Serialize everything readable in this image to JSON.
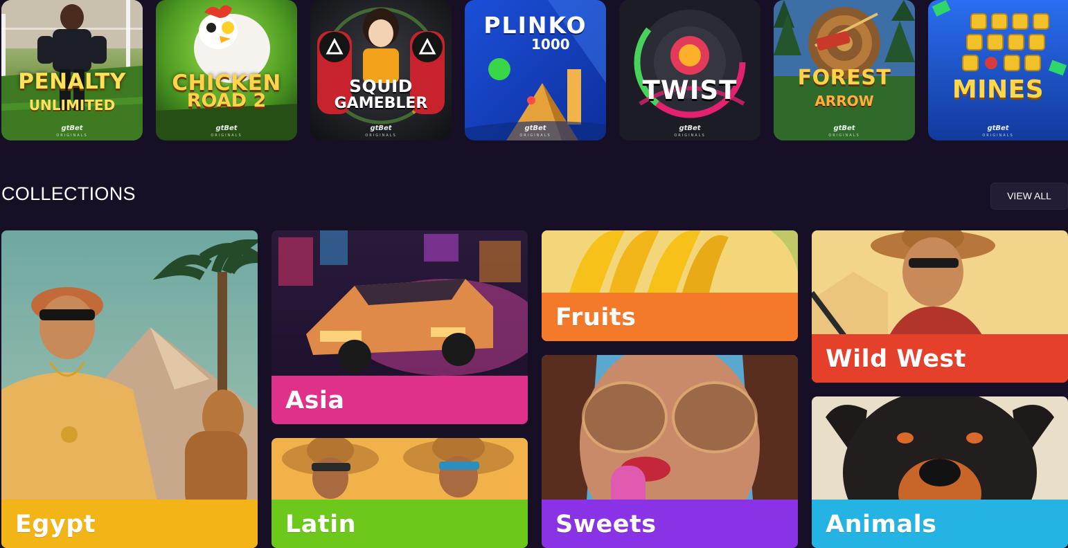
{
  "games": [
    {
      "title": "PENALTY",
      "subtitle": "UNLIMITED",
      "brand": "gtBet",
      "brand_sub": "ORIGINALS"
    },
    {
      "title": "CHICKEN",
      "subtitle": "ROAD 2",
      "brand": "gtBet",
      "brand_sub": "ORIGINALS"
    },
    {
      "title": "SQUID",
      "subtitle": "GAMEBLER",
      "brand": "gtBet",
      "brand_sub": "ORIGINALS"
    },
    {
      "title": "PLINKO",
      "subtitle": "1000",
      "brand": "gtBet",
      "brand_sub": "ORIGINALS"
    },
    {
      "title": "TWIST",
      "subtitle": "",
      "brand": "gtBet",
      "brand_sub": "ORIGINALS"
    },
    {
      "title": "FOREST",
      "subtitle": "ARROW",
      "brand": "gtBet",
      "brand_sub": "ORIGINALS"
    },
    {
      "title": "MINES",
      "subtitle": "",
      "brand": "gtBet",
      "brand_sub": "ORIGINALS"
    }
  ],
  "collections": {
    "title": "COLLECTIONS",
    "view_all_label": "VIEW ALL",
    "items": [
      {
        "label": "Egypt",
        "color": "#f2b417"
      },
      {
        "label": "Asia",
        "color": "#e0318a"
      },
      {
        "label": "Latin",
        "color": "#6cc81a"
      },
      {
        "label": "Fruits",
        "color": "#f47a2a"
      },
      {
        "label": "Sweets",
        "color": "#8a32e6"
      },
      {
        "label": "Wild West",
        "color": "#e5402a"
      },
      {
        "label": "Animals",
        "color": "#25b3e3"
      }
    ]
  },
  "colors": {
    "page_bg": "#170f26",
    "button_bg": "#241b35"
  }
}
